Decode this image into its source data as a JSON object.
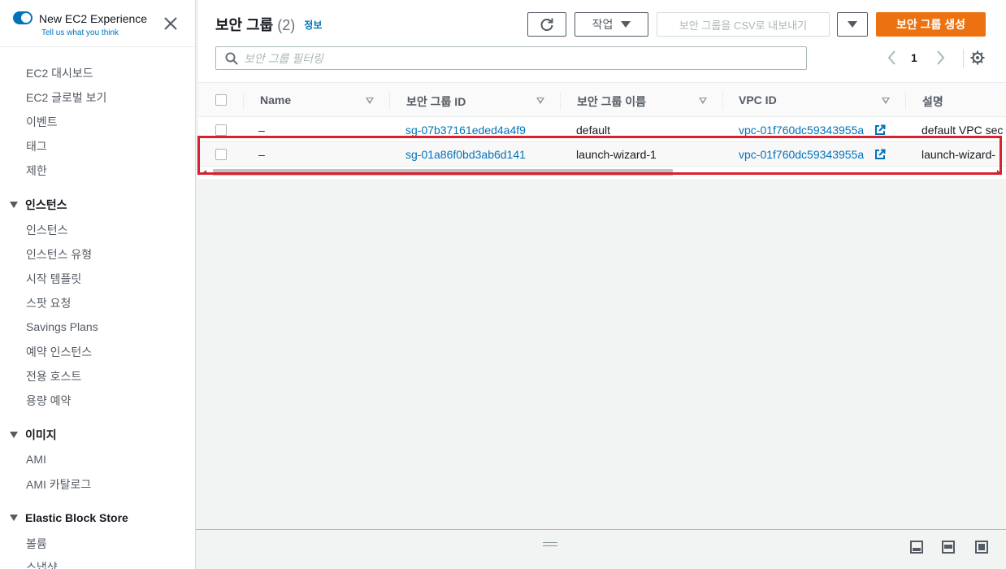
{
  "sidebar": {
    "toggle_title": "New EC2 Experience",
    "toggle_subtitle": "Tell us what you think",
    "items_top": [
      "EC2 대시보드",
      "EC2 글로벌 보기",
      "이벤트",
      "태그",
      "제한"
    ],
    "sections": [
      {
        "title": "인스턴스",
        "items": [
          "인스턴스",
          "인스턴스 유형",
          "시작 템플릿",
          "스팟 요청",
          "Savings Plans",
          "예약 인스턴스",
          "전용 호스트",
          "용량 예약"
        ]
      },
      {
        "title": "이미지",
        "items": [
          "AMI",
          "AMI 카탈로그"
        ]
      },
      {
        "title": "Elastic Block Store",
        "items": [
          "볼륨",
          "스냅샷"
        ]
      }
    ]
  },
  "header": {
    "title": "보안 그룹",
    "count": "(2)",
    "info": "정보"
  },
  "toolbar": {
    "actions_label": "작업",
    "export_label": "보안 그룹을 CSV로 내보내기",
    "create_label": "보안 그룹 생성"
  },
  "search": {
    "placeholder": "보안 그룹 필터링"
  },
  "pagination": {
    "page": "1"
  },
  "table": {
    "columns": [
      "Name",
      "보안 그룹 ID",
      "보안 그룹 이름",
      "VPC ID",
      "설명"
    ],
    "rows": [
      {
        "name": "–",
        "group_id": "sg-07b37161eded4a4f9",
        "group_name": "default",
        "vpc_id": "vpc-01f760dc59343955a",
        "description": "default VPC sec"
      },
      {
        "name": "–",
        "group_id": "sg-01a86f0bd3ab6d141",
        "group_name": "launch-wizard-1",
        "vpc_id": "vpc-01f760dc59343955a",
        "description": "launch-wizard-"
      }
    ]
  },
  "colors": {
    "accent": "#0073bb",
    "primary_button": "#ec7211",
    "highlight": "#d9202e"
  }
}
